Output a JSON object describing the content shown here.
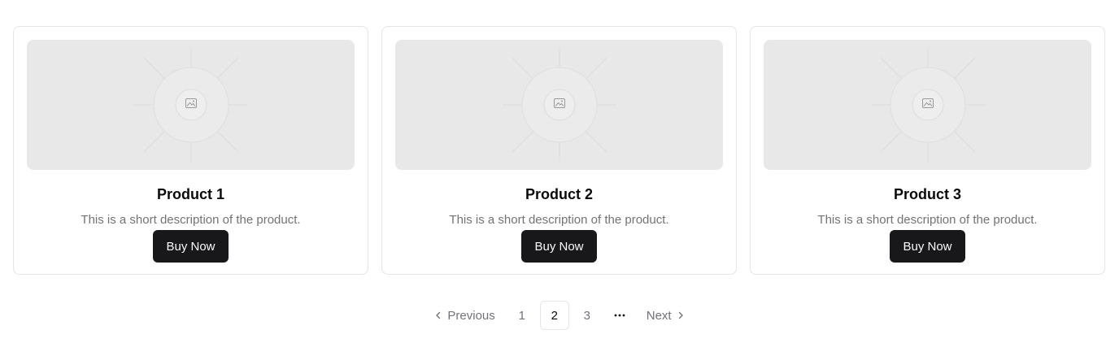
{
  "products": [
    {
      "title": "Product 1",
      "description": "This is a short description of the product.",
      "button_label": "Buy Now",
      "image_icon": "image-icon"
    },
    {
      "title": "Product 2",
      "description": "This is a short description of the product.",
      "button_label": "Buy Now",
      "image_icon": "image-icon"
    },
    {
      "title": "Product 3",
      "description": "This is a short description of the product.",
      "button_label": "Buy Now",
      "image_icon": "image-icon"
    }
  ],
  "pagination": {
    "previous_label": "Previous",
    "next_label": "Next",
    "pages": [
      "1",
      "2",
      "3"
    ],
    "current_page": "2",
    "ellipsis": "···",
    "previous_icon": "chevron-left-icon",
    "next_icon": "chevron-right-icon"
  },
  "colors": {
    "button_bg": "#18181b",
    "placeholder_bg": "#e8e8e8",
    "muted_text": "#737373",
    "border": "#e5e5e5"
  }
}
